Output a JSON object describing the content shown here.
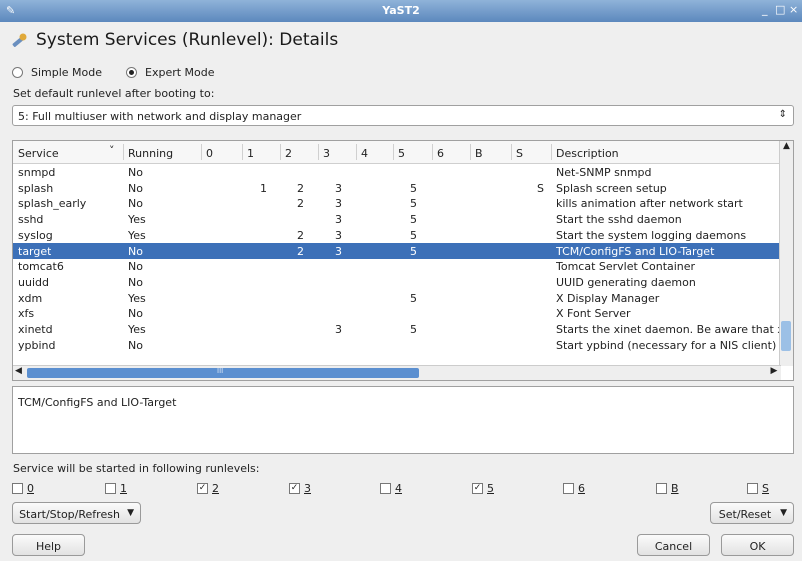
{
  "window": {
    "title": "YaST2",
    "minimize": "_",
    "maximize": "□",
    "close": "×"
  },
  "heading": {
    "title": "System Services (Runlevel): Details"
  },
  "modes": {
    "simple": "Simple Mode",
    "expert": "Expert Mode",
    "selected": "expert"
  },
  "default_runlevel": {
    "label": "Set default runlevel after booting to:",
    "value": "5: Full multiuser with network and display manager"
  },
  "table": {
    "columns": [
      "Service",
      "Running",
      "0",
      "1",
      "2",
      "3",
      "4",
      "5",
      "6",
      "B",
      "S",
      "Description"
    ],
    "sort_indicator": "˅",
    "rows": [
      {
        "service": "snmpd",
        "running": "No",
        "r0": "",
        "r1": "",
        "r2": "",
        "r3": "",
        "r4": "",
        "r5": "",
        "r6": "",
        "rB": "",
        "rS": "",
        "desc": "Net-SNMP snmpd"
      },
      {
        "service": "splash",
        "running": "No",
        "r0": "",
        "r1": "1",
        "r2": "2",
        "r3": "3",
        "r4": "",
        "r5": "5",
        "r6": "",
        "rB": "",
        "rS": "S",
        "desc": "Splash screen setup"
      },
      {
        "service": "splash_early",
        "running": "No",
        "r0": "",
        "r1": "",
        "r2": "2",
        "r3": "3",
        "r4": "",
        "r5": "5",
        "r6": "",
        "rB": "",
        "rS": "",
        "desc": "kills animation after network start"
      },
      {
        "service": "sshd",
        "running": "Yes",
        "r0": "",
        "r1": "",
        "r2": "",
        "r3": "3",
        "r4": "",
        "r5": "5",
        "r6": "",
        "rB": "",
        "rS": "",
        "desc": "Start the sshd daemon"
      },
      {
        "service": "syslog",
        "running": "Yes",
        "r0": "",
        "r1": "",
        "r2": "2",
        "r3": "3",
        "r4": "",
        "r5": "5",
        "r6": "",
        "rB": "",
        "rS": "",
        "desc": "Start the system logging daemons"
      },
      {
        "service": "target",
        "running": "No",
        "r0": "",
        "r1": "",
        "r2": "2",
        "r3": "3",
        "r4": "",
        "r5": "5",
        "r6": "",
        "rB": "",
        "rS": "",
        "desc": "TCM/ConfigFS and LIO-Target",
        "selected": true
      },
      {
        "service": "tomcat6",
        "running": "No",
        "r0": "",
        "r1": "",
        "r2": "",
        "r3": "",
        "r4": "",
        "r5": "",
        "r6": "",
        "rB": "",
        "rS": "",
        "desc": "Tomcat Servlet Container"
      },
      {
        "service": "uuidd",
        "running": "No",
        "r0": "",
        "r1": "",
        "r2": "",
        "r3": "",
        "r4": "",
        "r5": "",
        "r6": "",
        "rB": "",
        "rS": "",
        "desc": "UUID generating daemon"
      },
      {
        "service": "xdm",
        "running": "Yes",
        "r0": "",
        "r1": "",
        "r2": "",
        "r3": "",
        "r4": "",
        "r5": "5",
        "r6": "",
        "rB": "",
        "rS": "",
        "desc": "X Display Manager"
      },
      {
        "service": "xfs",
        "running": "No",
        "r0": "",
        "r1": "",
        "r2": "",
        "r3": "",
        "r4": "",
        "r5": "",
        "r6": "",
        "rB": "",
        "rS": "",
        "desc": "X Font Server"
      },
      {
        "service": "xinetd",
        "running": "Yes",
        "r0": "",
        "r1": "",
        "r2": "",
        "r3": "3",
        "r4": "",
        "r5": "5",
        "r6": "",
        "rB": "",
        "rS": "",
        "desc": "Starts the xinet daemon. Be aware that xin"
      },
      {
        "service": "ypbind",
        "running": "No",
        "r0": "",
        "r1": "",
        "r2": "",
        "r3": "",
        "r4": "",
        "r5": "",
        "r6": "",
        "rB": "",
        "rS": "",
        "desc": "Start ypbind (necessary for a NIS client)"
      }
    ],
    "hscroll_grip": "III"
  },
  "description_box": {
    "text": "TCM/ConfigFS and LIO-Target"
  },
  "runlevels": {
    "label": "Service will be started in following runlevels:",
    "items": [
      {
        "label": "0",
        "checked": false
      },
      {
        "label": "1",
        "checked": false
      },
      {
        "label": "2",
        "checked": true
      },
      {
        "label": "3",
        "checked": true
      },
      {
        "label": "4",
        "checked": false
      },
      {
        "label": "5",
        "checked": true
      },
      {
        "label": "6",
        "checked": false
      },
      {
        "label": "B",
        "checked": false
      },
      {
        "label": "S",
        "checked": false
      }
    ]
  },
  "buttons": {
    "start_stop_refresh": "Start/Stop/Refresh",
    "set_reset": "Set/Reset",
    "help": "Help",
    "cancel": "Cancel",
    "ok": "OK"
  },
  "colors": {
    "selection": "#3c70b8",
    "titlebar": "#5c88bd"
  }
}
